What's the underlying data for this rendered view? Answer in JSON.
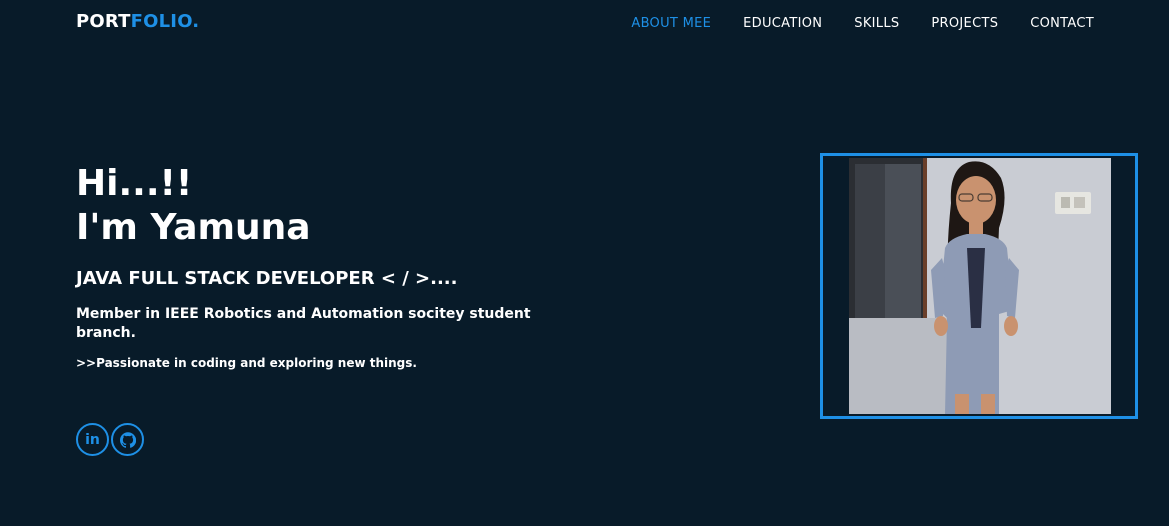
{
  "logo": {
    "part1": "PORT",
    "part2": "FOLIO."
  },
  "nav": {
    "items": [
      "ABOUT MEE",
      "EDUCATION",
      "SKILLS",
      "PROJECTS",
      "CONTACT"
    ],
    "active_index": 0
  },
  "hero": {
    "greeting_line1": "Hi...!!",
    "greeting_line2": "I'm Yamuna",
    "role": "JAVA FULL STACK DEVELOPER < / >....",
    "member": "Member in IEEE Robotics and Automation socitey student branch.",
    "passion": ">>Passionate in coding and exploring new things."
  },
  "socials": [
    {
      "icon": "linkedin-icon",
      "label": "in"
    },
    {
      "icon": "github-icon"
    }
  ],
  "colors": {
    "background": "#081b29",
    "accent": "#1e90e6",
    "text": "#ffffff"
  }
}
